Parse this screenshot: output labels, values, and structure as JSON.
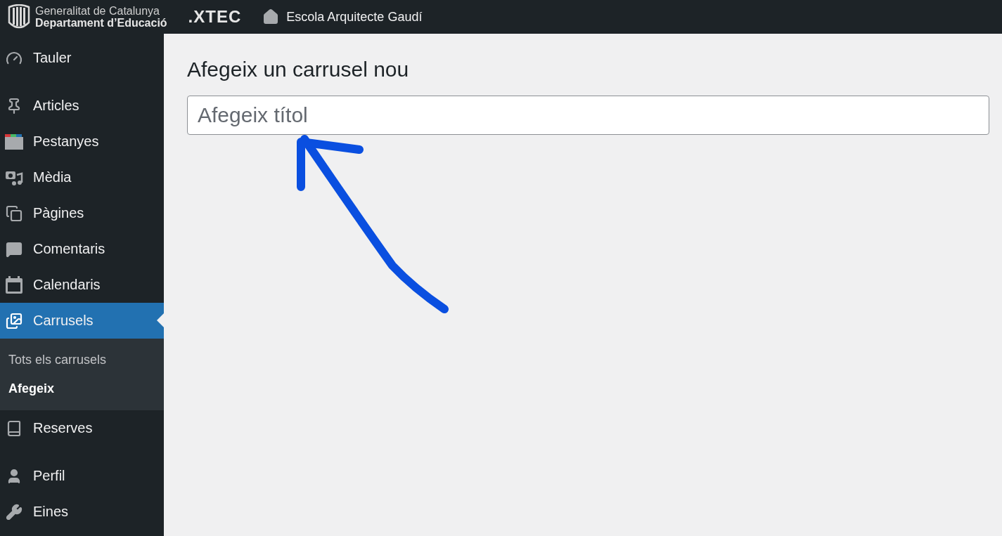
{
  "top_bar": {
    "logo_line_1": "Generalitat de Catalunya",
    "logo_line_2": "Departament d’Educació",
    "brand": ".XTEC",
    "site_name": "Escola Arquitecte Gaudí"
  },
  "sidebar": {
    "groups": [
      [
        {
          "label": "Tauler",
          "selected": false
        }
      ],
      [
        {
          "label": "Articles",
          "selected": false
        },
        {
          "label": "Pestanyes",
          "selected": false
        },
        {
          "label": "Mèdia",
          "selected": false
        },
        {
          "label": "Pàgines",
          "selected": false
        },
        {
          "label": "Comentaris",
          "selected": false
        },
        {
          "label": "Calendaris",
          "selected": false
        },
        {
          "label": "Carrusels",
          "selected": true,
          "children": [
            {
              "label": "Tots els carrusels",
              "selected": false
            },
            {
              "label": "Afegeix",
              "selected": true
            }
          ]
        },
        {
          "label": "Reserves",
          "selected": false
        }
      ],
      [
        {
          "label": "Perfil",
          "selected": false
        },
        {
          "label": "Eines",
          "selected": false
        }
      ]
    ]
  },
  "main": {
    "heading": "Afegeix un carrusel nou",
    "title_field": {
      "placeholder": "Afegeix títol"
    }
  }
}
